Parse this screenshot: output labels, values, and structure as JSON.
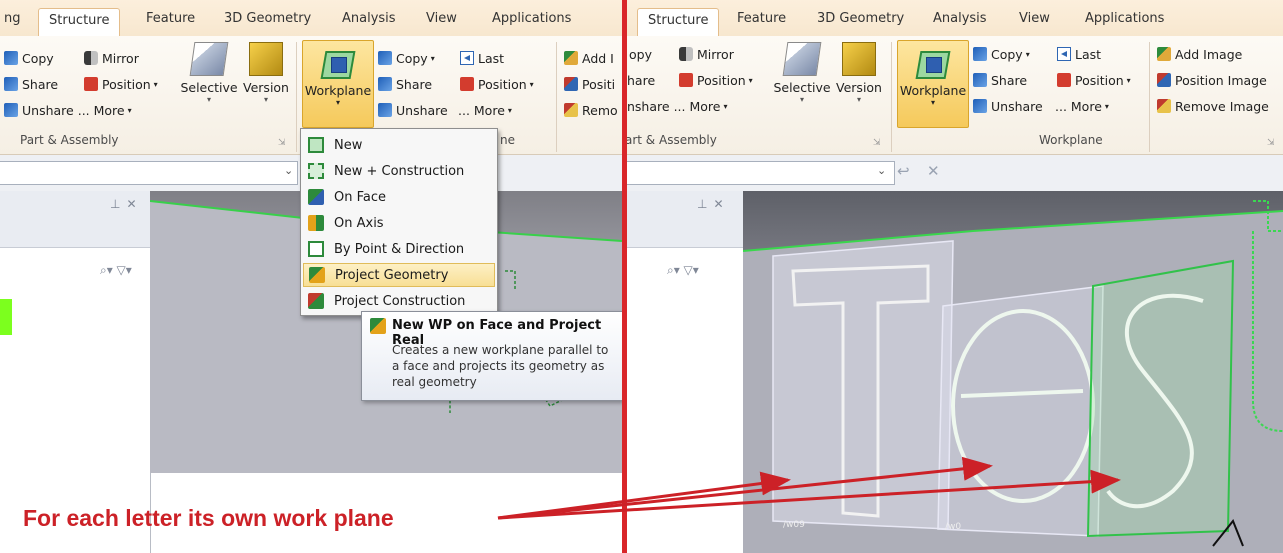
{
  "tabs": {
    "partial_left": "ng",
    "structure": "Structure",
    "feature": "Feature",
    "geometry3d": "3D Geometry",
    "analysis": "Analysis",
    "view": "View",
    "applications": "Applications"
  },
  "ribbon": {
    "copy": "Copy",
    "share": "Share",
    "unshare": "Unshare",
    "mirror": "Mirror",
    "position": "Position",
    "more": "... More",
    "selective": "Selective",
    "version": "Version",
    "workplane": "Workplane",
    "last": "Last",
    "add_image": "Add Image",
    "position_image": "Position Image",
    "remove_image": "Remove Image",
    "group_part_assembly": "Part & Assembly",
    "group_workplane": "Workplane"
  },
  "left_partial": {
    "add_image": "Add I",
    "position_image": "Positi",
    "remove_image": "Remo",
    "group_label_tail": "ne"
  },
  "right_partial": {
    "copy": "opy",
    "share": "hare",
    "unshare": "nshare",
    "group_part_assembly": "art & Assembly"
  },
  "workplane_menu": {
    "items": [
      "New",
      "New + Construction",
      "On Face",
      "On Axis",
      "By Point & Direction",
      "Project Geometry",
      "Project Construction"
    ],
    "highlighted": "Project Geometry"
  },
  "tooltip": {
    "title": "New WP on Face and Project Real",
    "description": "Creates a new workplane parallel to a face and projects its geometry as real geometry"
  },
  "viewport_text": {
    "word": "Test",
    "wp_label_1": "/w09",
    "wp_label_2": "/w0"
  },
  "annotation": "For each letter its own work plane",
  "colors": {
    "annotation_red": "#cc2127",
    "highlight_yellow": "#f8df95",
    "workplane_green": "#2d8a3b"
  }
}
